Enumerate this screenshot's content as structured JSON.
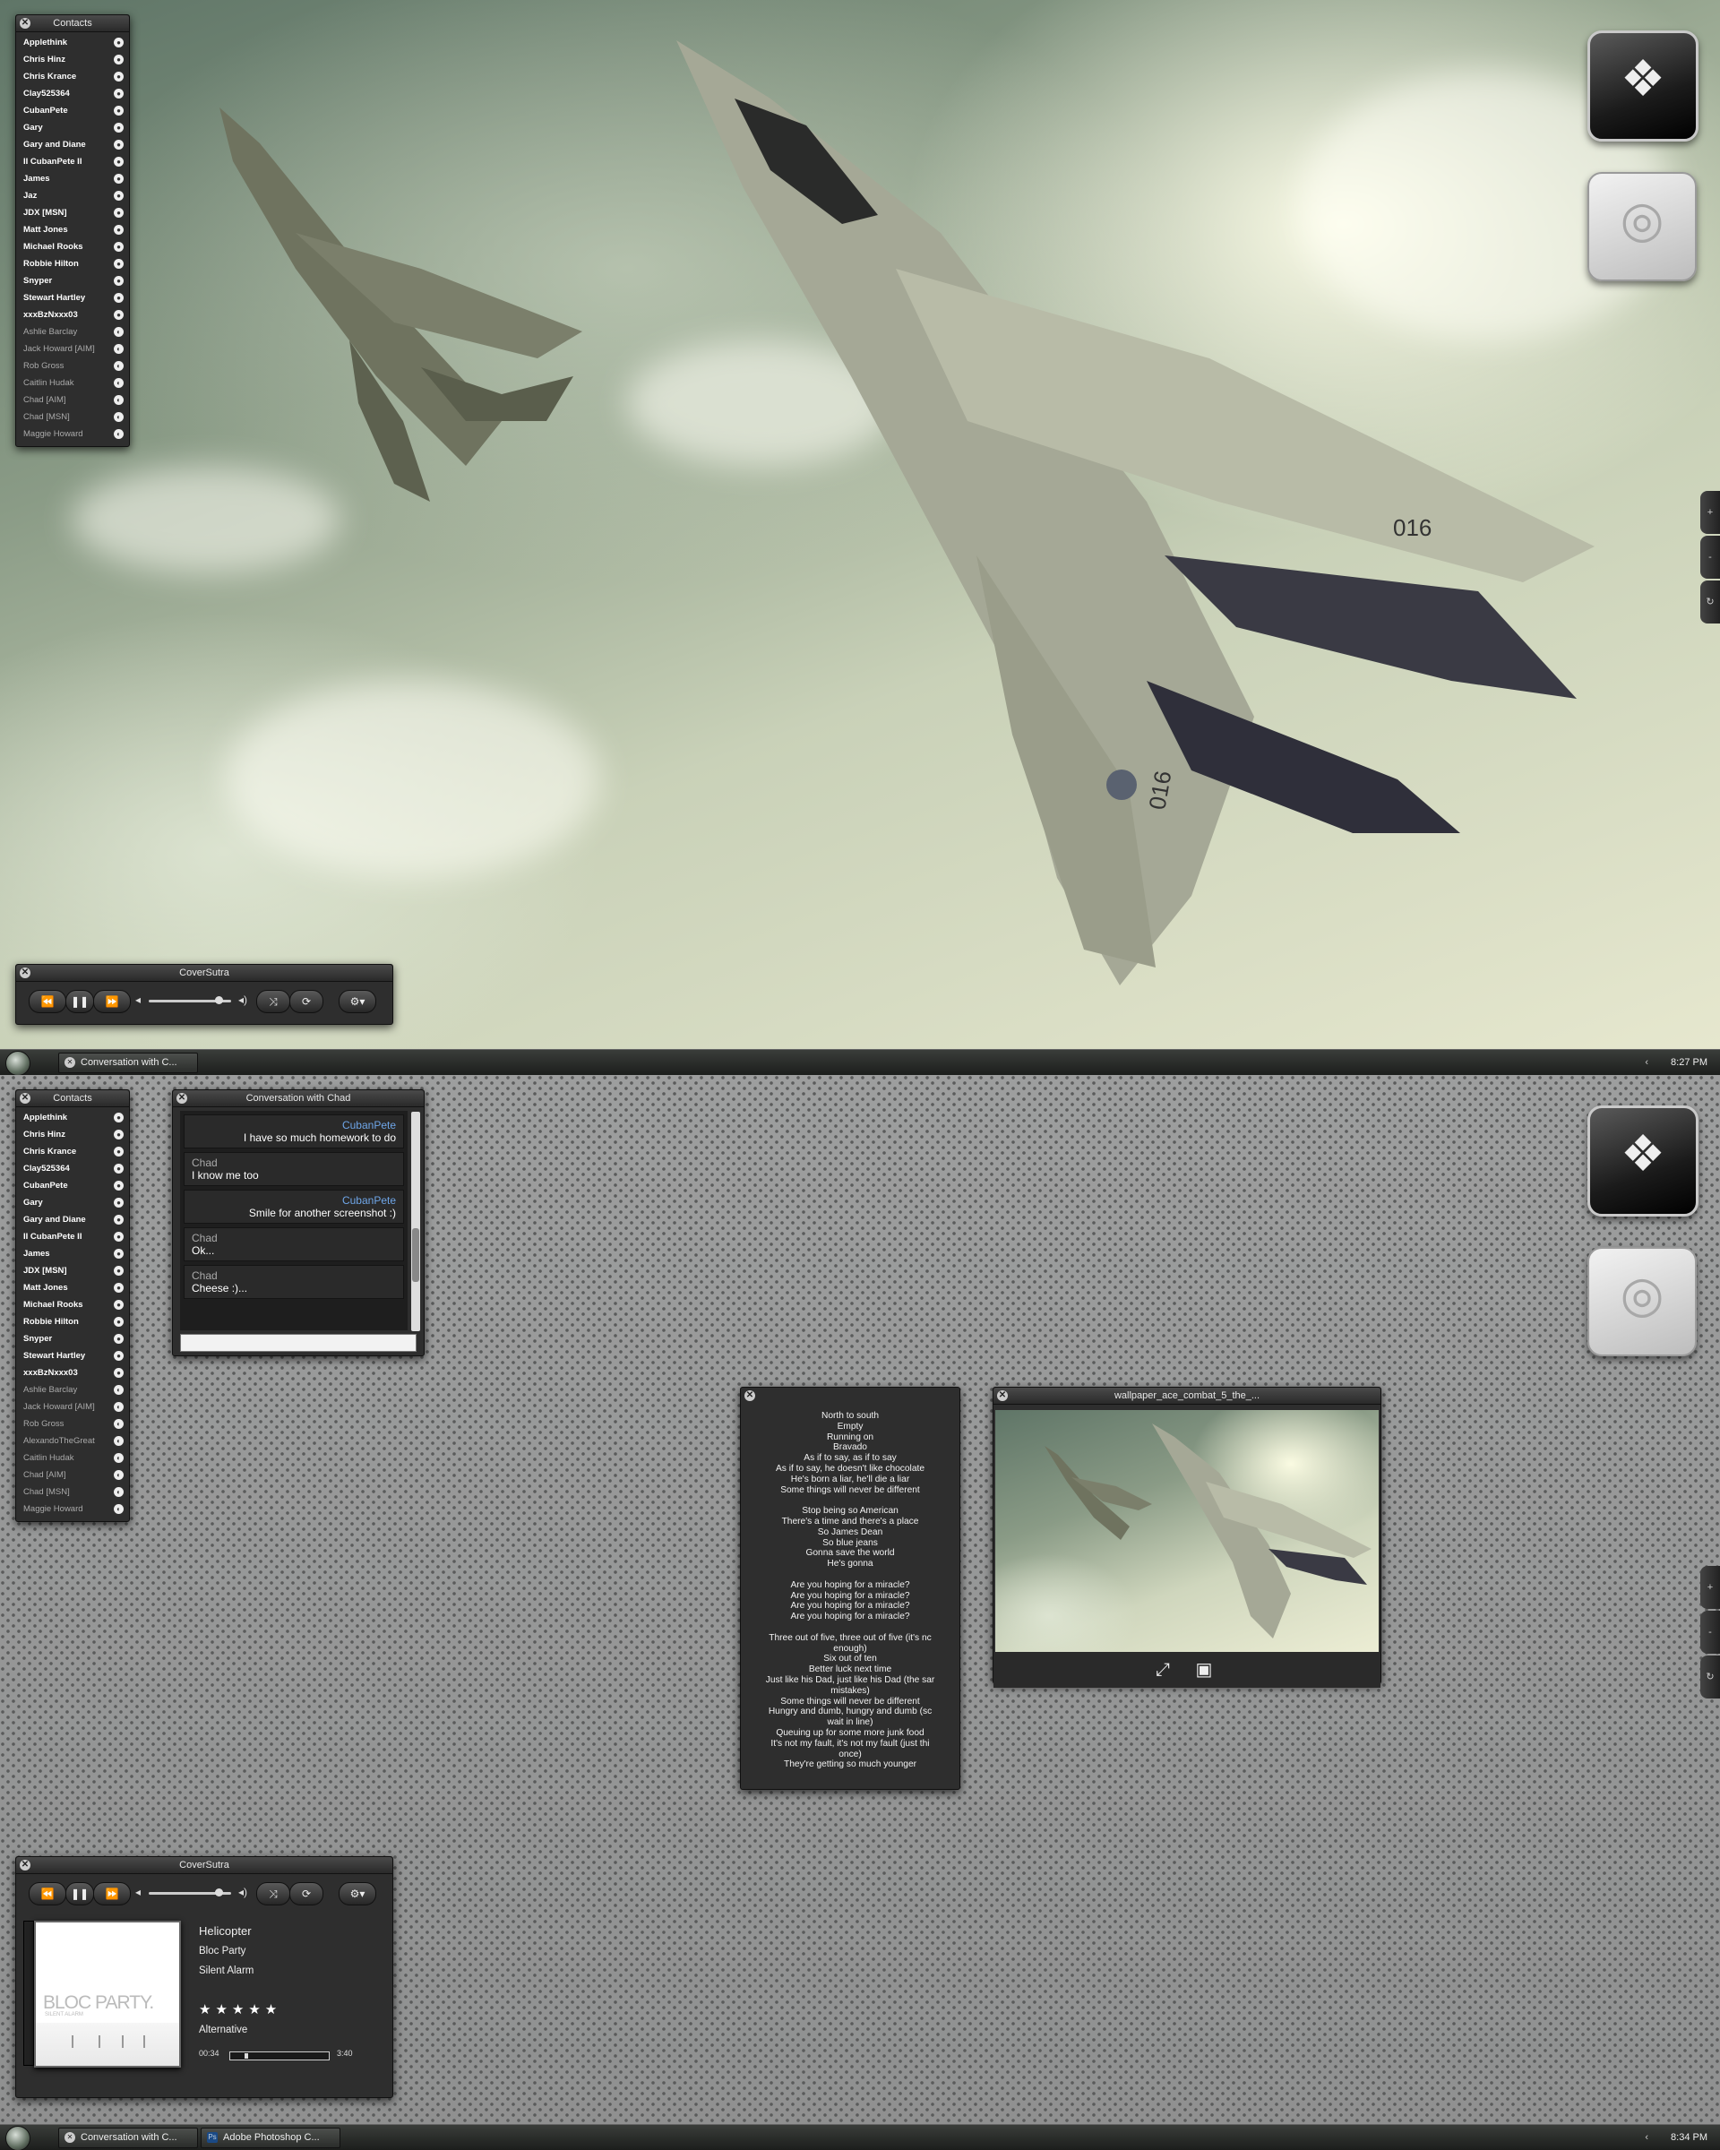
{
  "desktop_top": {
    "contacts_widget": {
      "title": "Contacts",
      "contacts": [
        {
          "name": "Applethink",
          "online": true
        },
        {
          "name": "Chris Hinz",
          "online": true
        },
        {
          "name": "Chris Krance",
          "online": true
        },
        {
          "name": "Clay525364",
          "online": true
        },
        {
          "name": "CubanPete",
          "online": true
        },
        {
          "name": "Gary",
          "online": true
        },
        {
          "name": "Gary and Diane",
          "online": true
        },
        {
          "name": "II CubanPete II",
          "online": true
        },
        {
          "name": "James",
          "online": true
        },
        {
          "name": "Jaz",
          "online": true
        },
        {
          "name": "JDX [MSN]",
          "online": true
        },
        {
          "name": "Matt Jones",
          "online": true
        },
        {
          "name": "Michael Rooks",
          "online": true
        },
        {
          "name": "Robbie Hilton",
          "online": true
        },
        {
          "name": "Snyper",
          "online": true
        },
        {
          "name": "Stewart Hartley",
          "online": true
        },
        {
          "name": "xxxBzNxxx03",
          "online": true
        },
        {
          "name": "Ashlie Barclay",
          "online": false
        },
        {
          "name": "Jack Howard [AIM]",
          "online": false
        },
        {
          "name": "Rob Gross",
          "online": false
        },
        {
          "name": "Caitlin Hudak",
          "online": false
        },
        {
          "name": "Chad [AIM]",
          "online": false
        },
        {
          "name": "Chad [MSN]",
          "online": false
        },
        {
          "name": "Maggie Howard",
          "online": false
        }
      ]
    },
    "player": {
      "title": "CoverSutra",
      "volume_level": 0.85
    },
    "taskbar": {
      "button_1": "Conversation with C...",
      "clock": "8:27 PM",
      "tray_chevron": "‹"
    },
    "drives": [
      {
        "name": "boot-camp-drive-icon"
      },
      {
        "name": "hard-drive-icon"
      }
    ],
    "side_tabs": [
      "+",
      "-",
      "↻"
    ],
    "wallpaper_text": {
      "tail_number": "016"
    }
  },
  "desktop_bottom": {
    "contacts_widget": {
      "title": "Contacts",
      "contacts": [
        {
          "name": "Applethink",
          "online": true
        },
        {
          "name": "Chris Hinz",
          "online": true
        },
        {
          "name": "Chris Krance",
          "online": true
        },
        {
          "name": "Clay525364",
          "online": true
        },
        {
          "name": "CubanPete",
          "online": true
        },
        {
          "name": "Gary",
          "online": true
        },
        {
          "name": "Gary and Diane",
          "online": true
        },
        {
          "name": "II CubanPete II",
          "online": true
        },
        {
          "name": "James",
          "online": true
        },
        {
          "name": "JDX [MSN]",
          "online": true
        },
        {
          "name": "Matt Jones",
          "online": true
        },
        {
          "name": "Michael Rooks",
          "online": true
        },
        {
          "name": "Robbie Hilton",
          "online": true
        },
        {
          "name": "Snyper",
          "online": true
        },
        {
          "name": "Stewart Hartley",
          "online": true
        },
        {
          "name": "xxxBzNxxx03",
          "online": true
        },
        {
          "name": "Ashlie Barclay",
          "online": false
        },
        {
          "name": "Jack Howard [AIM]",
          "online": false
        },
        {
          "name": "Rob Gross",
          "online": false
        },
        {
          "name": "AlexandoTheGreat",
          "online": false
        },
        {
          "name": "Caitlin Hudak",
          "online": false
        },
        {
          "name": "Chad [AIM]",
          "online": false
        },
        {
          "name": "Chad [MSN]",
          "online": false
        },
        {
          "name": "Maggie Howard",
          "online": false
        }
      ]
    },
    "chat": {
      "title": "Conversation with Chad",
      "messages": [
        {
          "sender": "CubanPete",
          "text": "I have so much homework to do",
          "self": true
        },
        {
          "sender": "Chad",
          "text": "I know me too",
          "self": false
        },
        {
          "sender": "CubanPete",
          "text": "Smile for another screenshot :)",
          "self": true
        },
        {
          "sender": "Chad",
          "text": "Ok...",
          "self": false
        },
        {
          "sender": "Chad",
          "text": "Cheese :)...",
          "self": false
        }
      ],
      "input_value": ""
    },
    "lyrics": {
      "text": "North to south\nEmpty\nRunning on\nBravado\nAs if to say, as if to say\nAs if to say, he doesn't like chocolate\nHe's born a liar, he'll die a liar\nSome things will never be different\n\nStop being so American\nThere's a time and there's a place\nSo James Dean\nSo blue jeans\nGonna save the world\nHe's gonna\n\nAre you hoping for a miracle?\nAre you hoping for a miracle?\nAre you hoping for a miracle?\nAre you hoping for a miracle?\n\nThree out of five, three out of five (it's nc\nenough)\nSix out of ten\nBetter luck next time\nJust like his Dad, just like his Dad (the sar\nmistakes)\nSome things will never be different\nHungry and dumb, hungry and dumb (sc\nwait in line)\nQueuing up for some more junk food\nIt's not my fault, it's not my fault (just thi\nonce)\nThey're getting so much younger"
    },
    "viewer": {
      "title": "wallpaper_ace_combat_5_the_..."
    },
    "player": {
      "title": "CoverSutra",
      "volume_level": 0.85,
      "track": "Helicopter",
      "artist": "Bloc Party",
      "album": "Silent Alarm",
      "rating_stars": "★★★★★",
      "rating": 5,
      "genre": "Alternative",
      "elapsed": "00:34",
      "duration": "3:40",
      "progress": 0.15,
      "cover_band": "BLOC PARTY.",
      "cover_album": "SILENT ALARM"
    },
    "taskbar": {
      "button_1": "Conversation with C...",
      "button_2": "Adobe Photoshop C...",
      "clock": "8:34 PM",
      "tray_chevron": "‹"
    },
    "drives": [
      {
        "name": "boot-camp-drive-icon"
      },
      {
        "name": "hard-drive-icon"
      }
    ],
    "side_tabs": [
      "+",
      "-",
      "↻"
    ]
  },
  "icons": {
    "close": "✕",
    "prev": "⏪",
    "pause": "❚❚",
    "next": "⏩",
    "shuffle": "⤨",
    "repeat": "⟳",
    "gear": "⚙▾",
    "vol_low": "◂",
    "vol_high": "◂)",
    "fullscreen": "⤢",
    "photo": "▣"
  },
  "colors": {
    "widget_bg": "#2e2e2e",
    "self_name": "#6fa6e8",
    "taskbar": "#2a2c2a"
  }
}
